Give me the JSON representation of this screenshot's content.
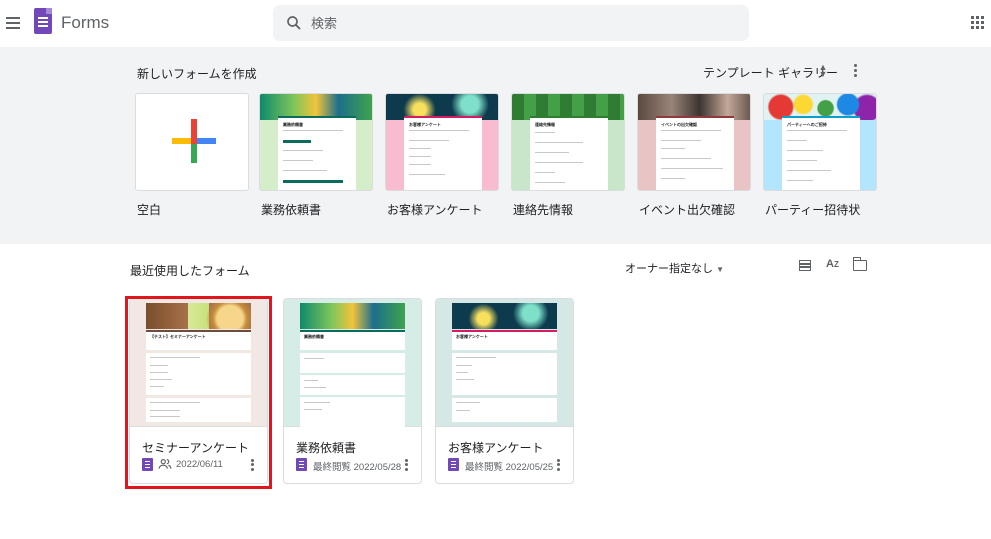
{
  "header": {
    "app_name": "Forms",
    "search_placeholder": "検索"
  },
  "templates": {
    "heading": "新しいフォームを作成",
    "gallery_label": "テンプレート ギャラリー",
    "items": [
      {
        "label": "空白"
      },
      {
        "label": "業務依頼書",
        "preview_title": "業務依頼書",
        "accent": "#0b6b5c"
      },
      {
        "label": "お客様アンケート",
        "preview_title": "お客様アンケート",
        "accent": "#d81b60"
      },
      {
        "label": "連絡先情報",
        "preview_title": "連絡先情報",
        "accent": "#2e7d32"
      },
      {
        "label": "イベント出欠確認",
        "preview_title": "イベントの出欠確認",
        "accent": "#8e3a3a"
      },
      {
        "label": "パーティー招待状",
        "preview_title": "パーティーへのご招待",
        "accent": "#0aa0c8"
      }
    ]
  },
  "recent": {
    "title": "最近使用したフォーム",
    "owner_filter": "オーナー指定なし",
    "forms": [
      {
        "title": "セミナーアンケート",
        "preview_title": "【テスト】セミナーアンケート",
        "date": "2022/06/11",
        "shared": true,
        "selected": true
      },
      {
        "title": "業務依頼書",
        "preview_title": "業務依頼書",
        "date": "最終閲覧 2022/05/28",
        "shared": false,
        "selected": false
      },
      {
        "title": "お客様アンケート",
        "preview_title": "お客様アンケート",
        "date": "最終閲覧 2022/05/25",
        "shared": false,
        "selected": false
      }
    ]
  },
  "colors": {
    "brand_purple": "#7248b9",
    "selection_red": "#e0161f",
    "template_bg": "#f1f3f4"
  },
  "icons": [
    "menu-icon",
    "forms-logo-icon",
    "search-icon",
    "apps-grid-icon",
    "unfold-icon",
    "more-vert-icon",
    "plus-icon",
    "list-view-icon",
    "sort-az-icon",
    "folder-icon",
    "shared-people-icon",
    "kebab-icon"
  ]
}
